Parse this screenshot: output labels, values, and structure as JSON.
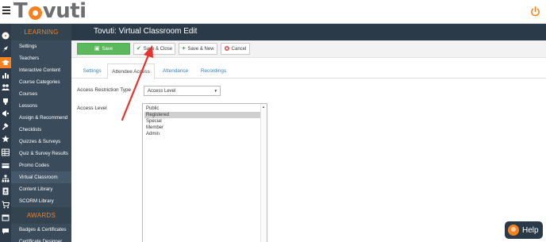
{
  "app": {
    "logo_text_first": "T",
    "logo_text_rest": "vuti",
    "page_title": "Tovuti: Virtual Classroom Edit"
  },
  "sidebar": {
    "section_learning": "LEARNING",
    "learning_items": [
      {
        "label": "Settings",
        "icon": "gauge-icon"
      },
      {
        "label": "Teachers",
        "icon": "rocket-icon"
      },
      {
        "label": "Interactive Content",
        "icon": "graduation-cap-icon"
      },
      {
        "label": "Course Categories",
        "icon": "bar-chart-icon"
      },
      {
        "label": "Courses",
        "icon": "users-icon"
      },
      {
        "label": "Lessons",
        "icon": "trophy-icon"
      },
      {
        "label": "Assign & Recommend",
        "icon": "megaphone-icon"
      },
      {
        "label": "Checklists",
        "icon": "gavel-icon"
      },
      {
        "label": "Quizzes & Surveys",
        "icon": "star-icon"
      },
      {
        "label": "Quiz & Survey Results",
        "icon": "table-icon"
      },
      {
        "label": "Promo Codes",
        "icon": "credit-card-icon"
      },
      {
        "label": "Virtual Classroom",
        "icon": "sitemap-icon"
      },
      {
        "label": "Content Library",
        "icon": "id-badge-icon"
      },
      {
        "label": "SCORM Library",
        "icon": "cart-icon"
      }
    ],
    "section_awards": "AWARDS",
    "award_items": [
      {
        "label": "Badges & Certificates",
        "icon": "calendar-icon"
      },
      {
        "label": "Certificate Designer",
        "icon": "chat-icon"
      }
    ]
  },
  "toolbar": {
    "save_label": "Save",
    "save_close_label": "Save & Close",
    "save_new_label": "Save & New",
    "cancel_label": "Cancel"
  },
  "tabs": [
    {
      "label": "Settings",
      "active": false
    },
    {
      "label": "Attendee Access",
      "active": true
    },
    {
      "label": "Attendance",
      "active": false
    },
    {
      "label": "Recordings",
      "active": false
    }
  ],
  "form": {
    "restriction_label": "Access Restriction Type",
    "restriction_value": "Access Level",
    "level_label": "Access Level",
    "level_options": [
      "Public",
      "Registered",
      "Special",
      "Member",
      "Admin"
    ],
    "level_selected": "Registered"
  },
  "help": {
    "label": "Help"
  },
  "colors": {
    "accent": "#f58220",
    "sidebar_bg": "#3a4b5c",
    "header_bg": "#2b3a48",
    "save_green": "#5cb85c",
    "annotation_red": "#e8322c"
  }
}
